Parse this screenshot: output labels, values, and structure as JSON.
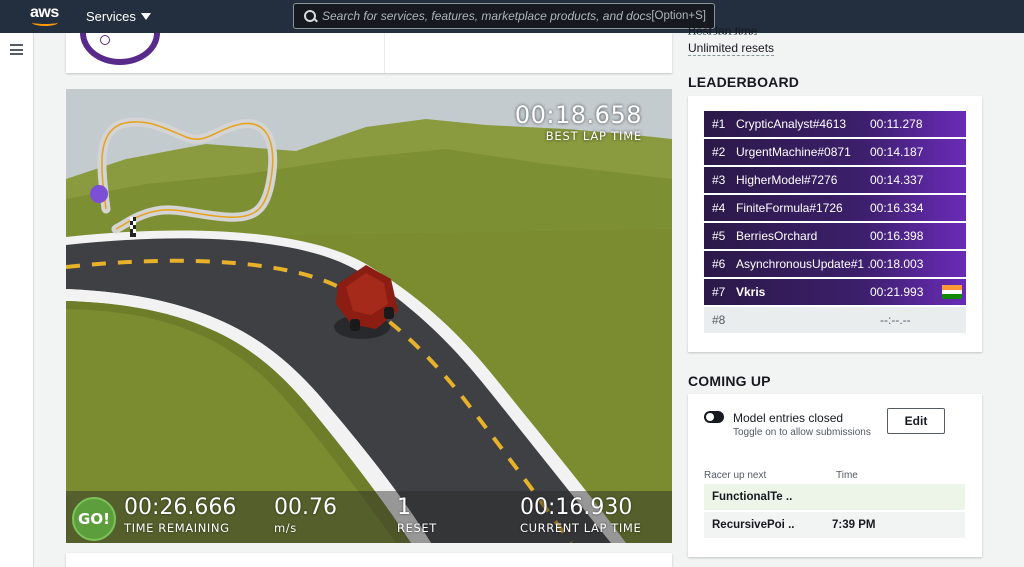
{
  "nav": {
    "logo_text": "aws",
    "services_label": "Services",
    "search_placeholder": "Search for services, features, marketplace products, and docs",
    "search_shortcut": "[Option+S]"
  },
  "race": {
    "best_lap_time": "00:18.658",
    "best_lap_label": "BEST LAP TIME",
    "go_label": "GO!",
    "time_remaining": "00:26.666",
    "time_remaining_label": "TIME REMAINING",
    "speed": "00.76",
    "speed_unit": "m/s",
    "resets": "1",
    "resets_label": "RESET",
    "current_lap_time": "00:16.930",
    "current_lap_label": "CURRENT LAP TIME"
  },
  "info": {
    "best_lap_partial": "Best lap time",
    "unlimited_resets": "Unlimited resets"
  },
  "leaderboard": {
    "title": "LEADERBOARD",
    "rows": [
      {
        "rank": "#1",
        "name": "CrypticAnalyst#4613",
        "time": "00:11.278"
      },
      {
        "rank": "#2",
        "name": "UrgentMachine#0871",
        "time": "00:14.187"
      },
      {
        "rank": "#3",
        "name": "HigherModel#7276",
        "time": "00:14.337"
      },
      {
        "rank": "#4",
        "name": "FiniteFormula#1726",
        "time": "00:16.334"
      },
      {
        "rank": "#5",
        "name": "BerriesOrchard",
        "time": "00:16.398"
      },
      {
        "rank": "#6",
        "name": "AsynchronousUpdate#1 ..",
        "time": "00:18.003"
      },
      {
        "rank": "#7",
        "name": "Vkris",
        "time": "00:21.993"
      },
      {
        "rank": "#8",
        "name": "",
        "time": "--:--.--"
      }
    ]
  },
  "coming_up": {
    "title": "COMING UP",
    "toggle_label": "Model entries closed",
    "toggle_desc": "Toggle on to allow submissions",
    "edit_label": "Edit",
    "col_racer": "Racer up next",
    "col_time": "Time",
    "rows": [
      {
        "racer": "FunctionalTe ..",
        "time": ""
      },
      {
        "racer": "RecursivePoi ..",
        "time": "7:39 PM"
      }
    ]
  },
  "colors": {
    "nav_bg": "#232f3e",
    "accent_orange": "#ff9900",
    "leaderboard_purple": "#3c1f6b",
    "go_green": "#5c9e3c"
  }
}
